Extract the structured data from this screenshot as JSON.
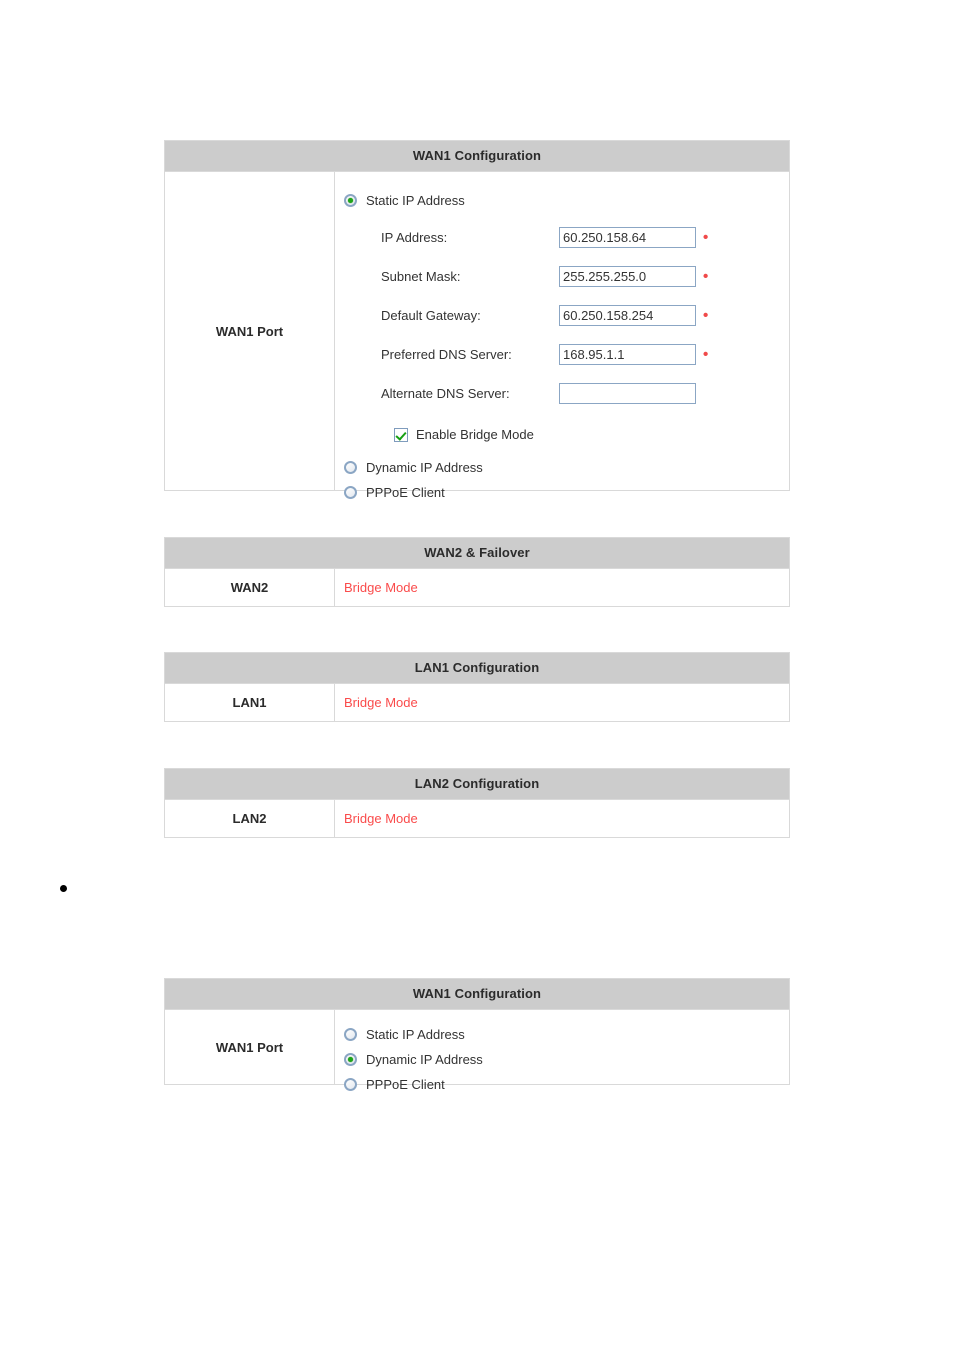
{
  "colors": {
    "header_bg": "#cccccc",
    "border": "#d9d9d9",
    "status_red": "#fa4b4b",
    "required_red": "#f04a4a",
    "radio_green": "#1ea519",
    "input_border": "#8ba6c4"
  },
  "wan1_static": {
    "header": "WAN1 Configuration",
    "port_label": "WAN1 Port",
    "modes": [
      {
        "label": "Static IP Address",
        "selected": true
      },
      {
        "label": "Dynamic IP Address",
        "selected": false
      },
      {
        "label": "PPPoE Client",
        "selected": false
      }
    ],
    "fields": [
      {
        "label": "IP Address:",
        "value": "60.250.158.64",
        "required": true
      },
      {
        "label": "Subnet Mask:",
        "value": "255.255.255.0",
        "required": true
      },
      {
        "label": "Default Gateway:",
        "value": "60.250.158.254",
        "required": true
      },
      {
        "label": "Preferred DNS Server:",
        "value": "168.95.1.1",
        "required": true
      },
      {
        "label": "Alternate DNS Server:",
        "value": "",
        "required": false
      }
    ],
    "bridge_mode": {
      "label": "Enable Bridge Mode",
      "checked": true
    }
  },
  "wan2": {
    "header": "WAN2 & Failover",
    "row_label": "WAN2",
    "status": "Bridge Mode"
  },
  "lan1": {
    "header": "LAN1 Configuration",
    "row_label": "LAN1",
    "status": "Bridge Mode"
  },
  "lan2": {
    "header": "LAN2 Configuration",
    "row_label": "LAN2",
    "status": "Bridge Mode"
  },
  "bullet": {
    "text": ""
  },
  "wan1_dynamic": {
    "header": "WAN1 Configuration",
    "port_label": "WAN1 Port",
    "modes": [
      {
        "label": "Static IP Address",
        "selected": false
      },
      {
        "label": "Dynamic IP Address",
        "selected": true
      },
      {
        "label": "PPPoE Client",
        "selected": false
      }
    ]
  }
}
